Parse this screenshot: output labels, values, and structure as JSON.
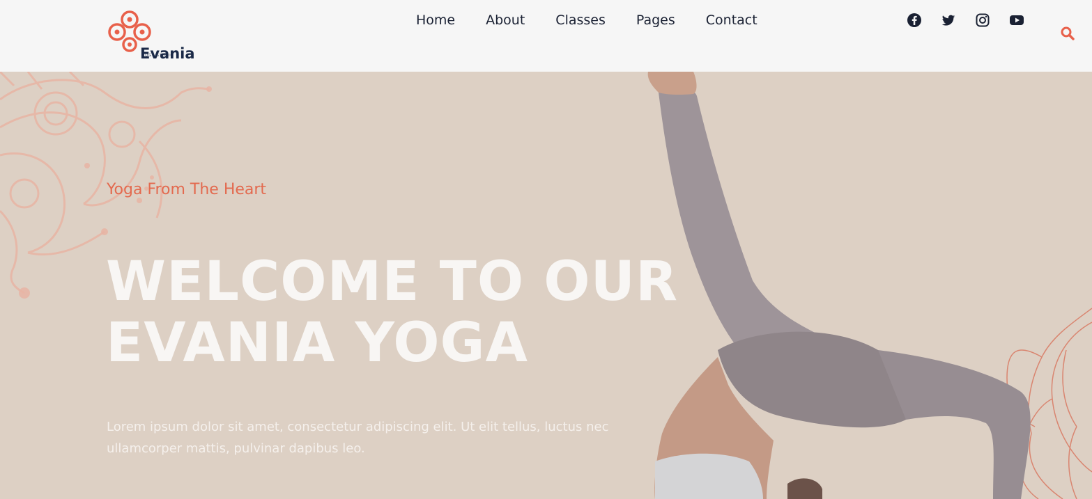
{
  "header": {
    "logo": {
      "name": "Evania",
      "subtitle": "YOGA STUDIO"
    },
    "nav": [
      {
        "label": "Home"
      },
      {
        "label": "About"
      },
      {
        "label": "Classes"
      },
      {
        "label": "Pages"
      },
      {
        "label": "Contact"
      }
    ],
    "social_icons": [
      "facebook-icon",
      "twitter-icon",
      "instagram-icon",
      "youtube-icon"
    ],
    "search_icon": "search-icon"
  },
  "hero": {
    "tagline": "Yoga From The Heart",
    "title_line1": "WELCOME TO OUR",
    "title_line2": "EVANIA YOGA",
    "description": "Lorem ipsum dolor sit amet, consectetur adipiscing elit. Ut elit tellus, luctus nec ullamcorper mattis, pulvinar dapibus leo."
  },
  "colors": {
    "accent": "#e36a4f",
    "navy": "#1a2947",
    "hero_bg": "#ddd0c4",
    "header_bg": "#f6f6f6"
  }
}
